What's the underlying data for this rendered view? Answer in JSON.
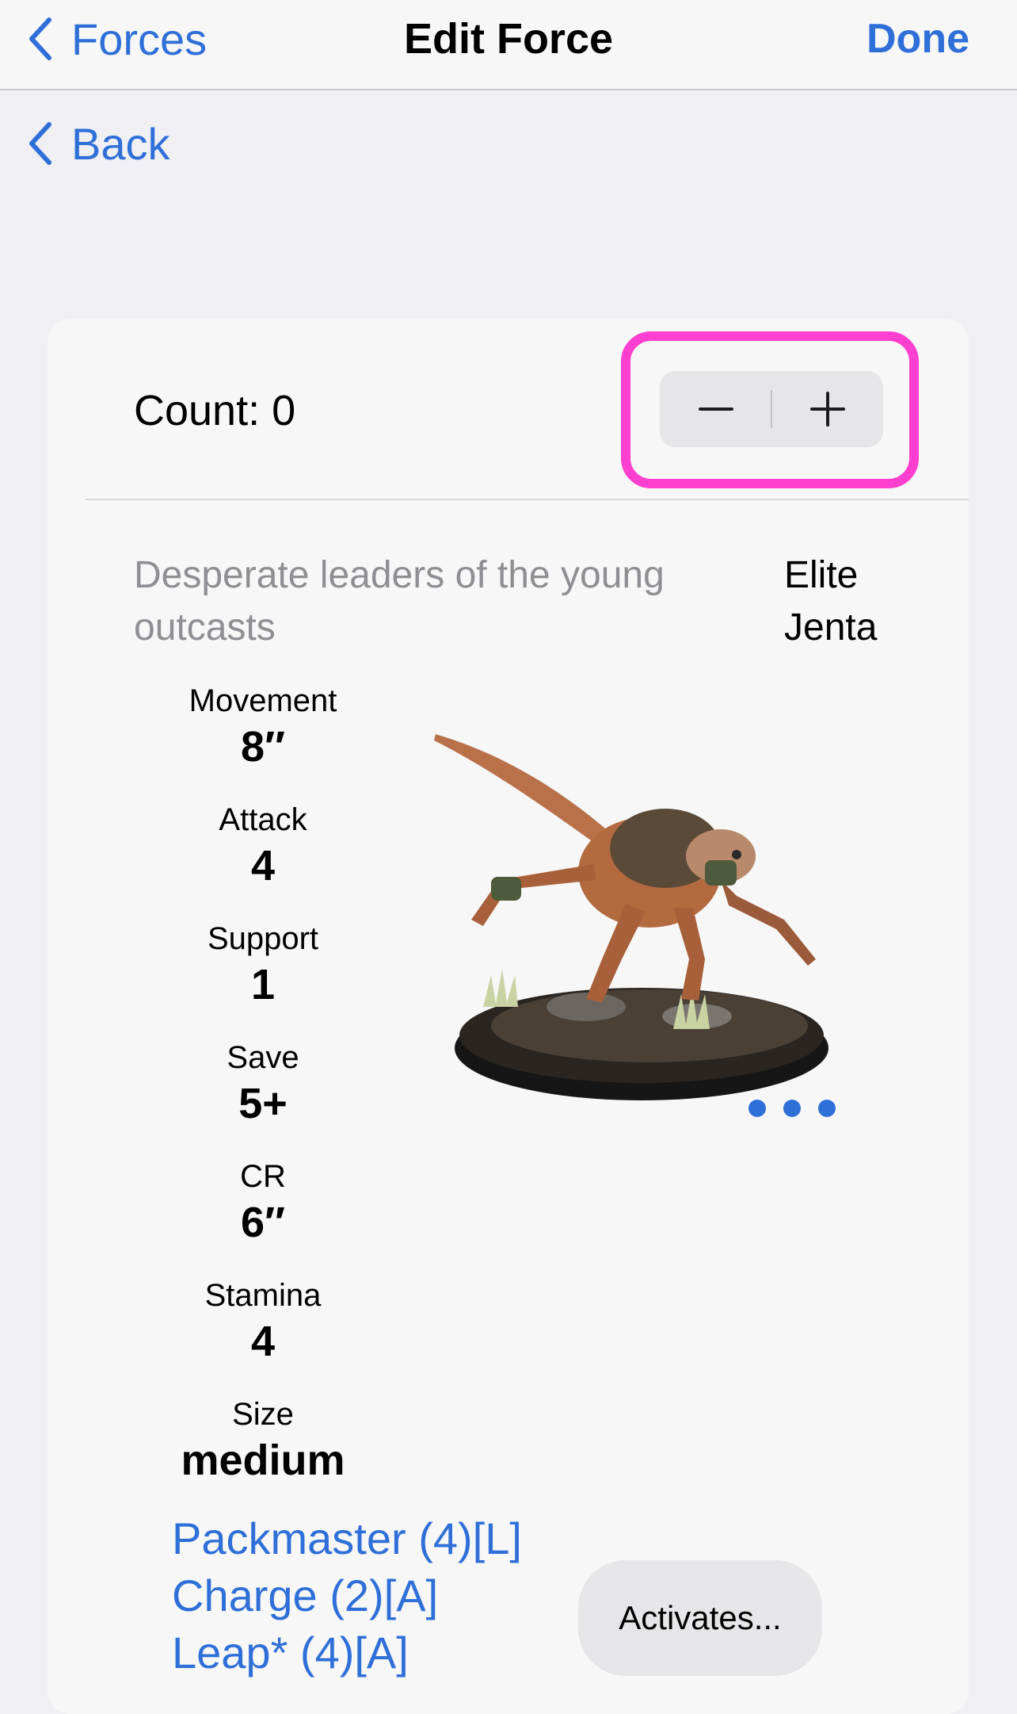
{
  "navbar": {
    "back_label": "Forces",
    "title": "Edit Force",
    "done_label": "Done"
  },
  "secondary_back": {
    "label": "Back"
  },
  "unit": {
    "count_label": "Count: 0",
    "stepper": {
      "minus_icon": "minus-icon",
      "plus_icon": "plus-icon"
    },
    "description": "Desperate leaders of the young outcasts",
    "name": "Elite Jenta",
    "stats": [
      {
        "label": "Movement",
        "value": "8″"
      },
      {
        "label": "Attack",
        "value": "4"
      },
      {
        "label": "Support",
        "value": "1"
      },
      {
        "label": "Save",
        "value": "5+"
      },
      {
        "label": "CR",
        "value": "6″"
      },
      {
        "label": "Stamina",
        "value": "4"
      },
      {
        "label": "Size",
        "value": "medium"
      }
    ],
    "image_icon": "miniature-photo",
    "more_icon": "ellipsis-icon",
    "abilities": [
      "Packmaster (4)[L]",
      "Charge (2)[A]",
      "Leap* (4)[A]"
    ],
    "activates_label": "Activates..."
  },
  "colors": {
    "accent": "#2f6fd8",
    "highlight": "#ff3fd0",
    "background": "#efeff4",
    "card": "#f7f7f7",
    "secondary_text": "#8e8e93"
  }
}
